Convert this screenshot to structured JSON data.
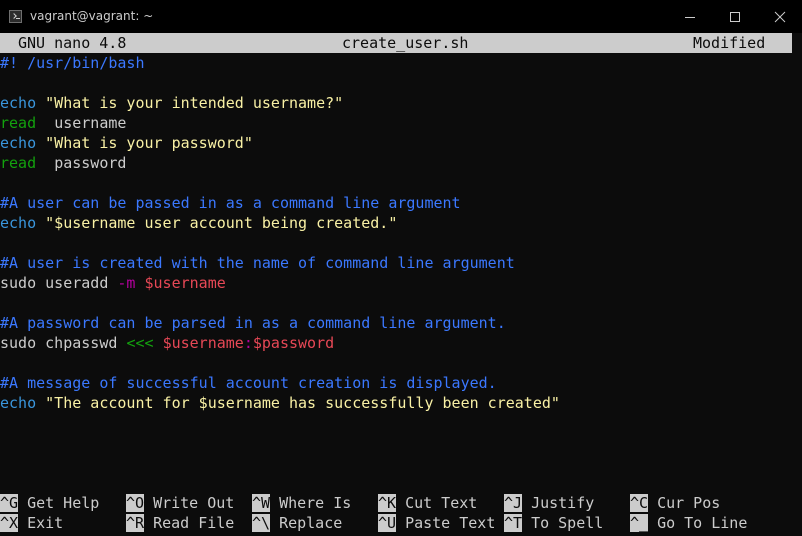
{
  "window": {
    "title": "vagrant@vagrant: ~"
  },
  "nano": {
    "app": "GNU nano 4.8",
    "filename": "create_user.sh",
    "status": "Modified"
  },
  "lines": [
    {
      "text": "#! /usr/bin/bash"
    },
    {
      "text": ""
    },
    {
      "cmd": "echo",
      "arg": "\"What is your intended username?\""
    },
    {
      "cmd": "read",
      "arg": "username"
    },
    {
      "cmd": "echo",
      "arg": "\"What is your password\""
    },
    {
      "cmd": "read",
      "arg": "password"
    },
    {
      "text": ""
    },
    {
      "text": "#A user can be passed in as a command line argument"
    },
    {
      "cmd": "echo",
      "arg": "\"$username user account being created.\""
    },
    {
      "text": ""
    },
    {
      "text": "#A user is created with the name of command line argument"
    },
    {
      "cmd": "sudo useradd",
      "opt": "-m",
      "var": "$username"
    },
    {
      "text": ""
    },
    {
      "text": "#A password can be parsed in as a command line argument."
    },
    {
      "cmd": "sudo chpasswd",
      "op": "<<<",
      "var1": "$username",
      "sep": ":",
      "var2": "$password"
    },
    {
      "text": ""
    },
    {
      "text": "#A message of successful account creation is displayed."
    },
    {
      "cmd": "echo",
      "arg": "\"The account for $username has successfully been created\""
    }
  ],
  "shortcuts": [
    {
      "key": "^G",
      "label": "Get Help"
    },
    {
      "key": "^O",
      "label": "Write Out"
    },
    {
      "key": "^W",
      "label": "Where Is"
    },
    {
      "key": "^K",
      "label": "Cut Text"
    },
    {
      "key": "^J",
      "label": "Justify"
    },
    {
      "key": "^C",
      "label": "Cur Pos"
    },
    {
      "key": "^X",
      "label": "Exit"
    },
    {
      "key": "^R",
      "label": "Read File"
    },
    {
      "key": "^\\",
      "label": "Replace"
    },
    {
      "key": "^U",
      "label": "Paste Text"
    },
    {
      "key": "^T",
      "label": "To Spell"
    },
    {
      "key": "^_",
      "label": "Go To Line"
    }
  ]
}
